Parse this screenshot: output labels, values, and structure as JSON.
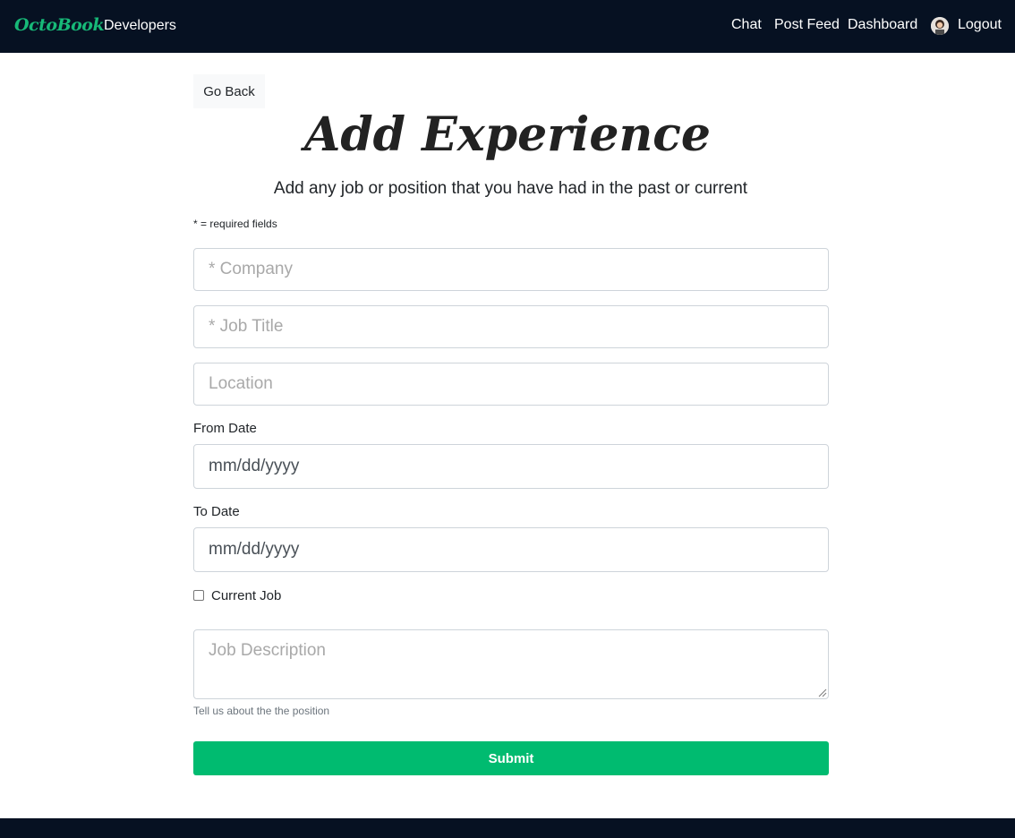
{
  "nav": {
    "brand": "OctoBook",
    "developers": "Developers",
    "chat": "Chat",
    "post_feed": "Post Feed",
    "dashboard": "Dashboard",
    "logout": "Logout"
  },
  "page": {
    "go_back": "Go Back",
    "title": "Add Experience",
    "lead": "Add any job or position that you have had in the past or current",
    "required_note": "* = required fields"
  },
  "form": {
    "company_placeholder": "* Company",
    "job_title_placeholder": "* Job Title",
    "location_placeholder": "Location",
    "from_label": "From Date",
    "from_value": "mm/dd/yyyy",
    "to_label": "To Date",
    "to_value": "mm/dd/yyyy",
    "current_job_label": "Current Job",
    "description_placeholder": "Job Description",
    "description_help": "Tell us about the the position",
    "submit": "Submit"
  },
  "colors": {
    "navbar": "#061122",
    "brand": "#17b978",
    "submit": "#00bb70"
  }
}
